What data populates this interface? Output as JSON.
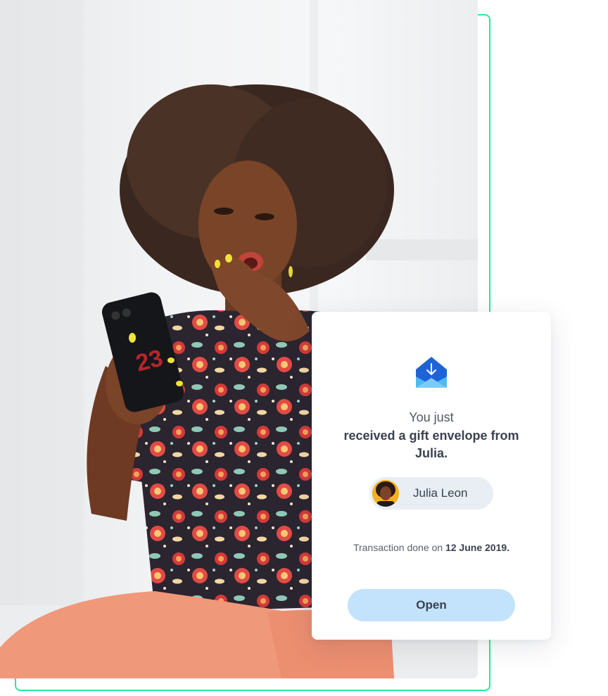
{
  "card": {
    "intro": "You just",
    "message": "received a gift envelope from Julia.",
    "sender_name": "Julia Leon",
    "transaction_prefix": "Transaction done on ",
    "transaction_date": "12 June 2019.",
    "open_label": "Open"
  },
  "icons": {
    "envelope": "envelope-download-icon",
    "avatar": "avatar"
  },
  "colors": {
    "frame_accent": "#2ee59d",
    "envelope_dark": "#1e63d6",
    "envelope_light": "#4fb8f2",
    "button_bg": "#c2e3fb",
    "pill_bg": "#e8eef4",
    "text_dark": "#3a4150"
  }
}
